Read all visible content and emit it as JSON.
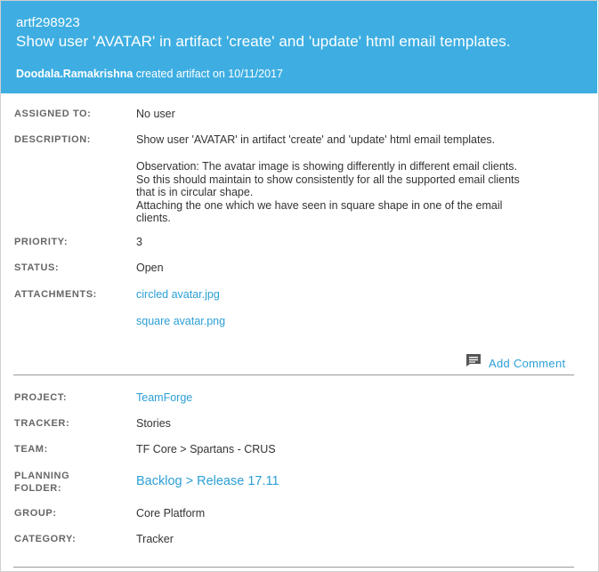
{
  "header": {
    "artifact_id": "artf298923",
    "title": "Show user 'AVATAR' in artifact 'create' and 'update' html email templates.",
    "creator": "Doodala.Ramakrishna",
    "created_text": " created artifact on 10/11/2017"
  },
  "fields": {
    "assigned_to": {
      "label": "ASSIGNED TO:",
      "value": "No user"
    },
    "description": {
      "label": "DESCRIPTION:",
      "line1": "Show user  'AVATAR' in artifact 'create' and 'update' html email templates.",
      "observation": "Observation: The avatar image is showing differently in different email clients.\nSo this should maintain to show consistently for all the supported email clients\nthat is in circular shape.\nAttaching the one which we have seen in square shape in one of the email\nclients."
    },
    "priority": {
      "label": "PRIORITY:",
      "value": "3"
    },
    "status": {
      "label": "STATUS:",
      "value": "Open"
    },
    "attachments": {
      "label": "ATTACHMENTS:",
      "items": [
        "circled avatar.jpg",
        "square avatar.png"
      ]
    }
  },
  "actions": {
    "add_comment": "Add Comment"
  },
  "details": {
    "project": {
      "label": "PROJECT:",
      "value": "TeamForge"
    },
    "tracker": {
      "label": "TRACKER:",
      "value": "Stories"
    },
    "team": {
      "label": "TEAM:",
      "value": "TF Core > Spartans - CRUS"
    },
    "planning_folder": {
      "label": "PLANNING\nFOLDER:",
      "value": "Backlog > Release 17.11"
    },
    "group": {
      "label": "GROUP:",
      "value": "Core Platform"
    },
    "category": {
      "label": "CATEGORY:",
      "value": "Tracker"
    }
  },
  "icons": {
    "comment": "comment-icon"
  },
  "colors": {
    "header_bg": "#3eaee2",
    "link": "#2c9fd6"
  }
}
